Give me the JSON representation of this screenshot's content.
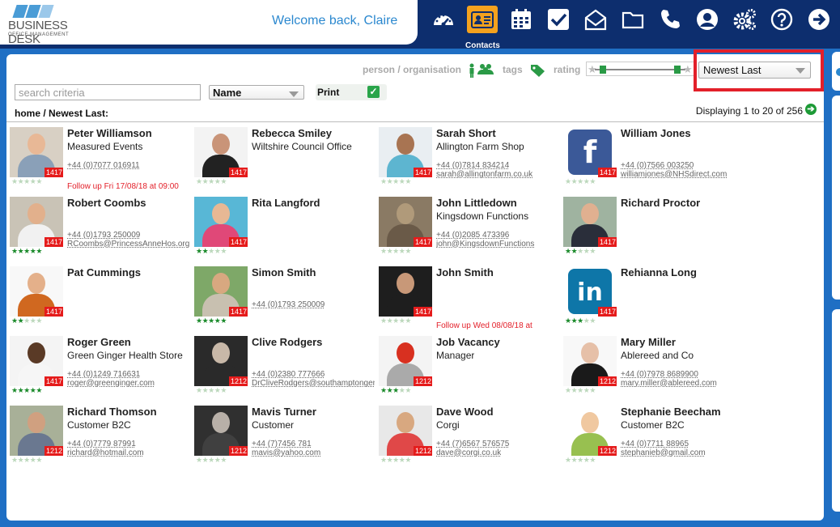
{
  "brand": {
    "name": "BUSINESS DESK",
    "tagline": "OFFICE MANAGEMENT"
  },
  "header": {
    "welcome": "Welcome back, Claire",
    "active_label": "Contacts"
  },
  "nav_icons": [
    "dashboard-icon",
    "contacts-icon",
    "calendar-icon",
    "tasks-icon",
    "mail-icon",
    "folder-icon",
    "phone-icon",
    "user-icon",
    "settings-icon",
    "help-icon",
    "logout-icon"
  ],
  "filters": {
    "person_org": "person / organisation",
    "tags": "tags",
    "rating": "rating"
  },
  "sort": {
    "selected": "Newest Last"
  },
  "search": {
    "placeholder": "search criteria",
    "field": "Name",
    "print": "Print"
  },
  "breadcrumb": "home / Newest Last:",
  "display": "Displaying 1 to 20 of 256",
  "colors": {
    "accent": "#f4a21e",
    "nav_bg": "#0d2e6e",
    "highlight": "#e3202a",
    "link": "#2b88cf"
  },
  "contacts": [
    {
      "name": "Peter Williamson",
      "org": "Measured Events",
      "phone": "+44 (0)7077 016911",
      "email": "",
      "badge": "1417",
      "rating": 0,
      "follow": "Follow up Fri 17/08/18 at 09:00",
      "photo": "#d8d0c4",
      "skin": "#e8b896",
      "shirt": "#8aa0b8"
    },
    {
      "name": "Rebecca Smiley",
      "org": "Wiltshire Council Office",
      "phone": "",
      "email": "",
      "badge": "1417",
      "rating": 0,
      "follow": "",
      "photo": "#f3f3f3",
      "skin": "#c99478",
      "shirt": "#222"
    },
    {
      "name": "Sarah Short",
      "org": "Allington Farm Shop",
      "phone": "+44 (0)7814 834214",
      "email": "sarah@allingtonfarm.co.uk",
      "badge": "1417",
      "rating": 0,
      "follow": "",
      "photo": "#e9eef2",
      "skin": "#a87452",
      "shirt": "#5db5d0"
    },
    {
      "name": "William Jones",
      "org": "",
      "phone": "+44 (0)7566 003250",
      "email": "williamjones@NHSdirect.com",
      "badge": "1417",
      "rating": 0,
      "follow": "",
      "photo": "fb",
      "skin": "",
      "shirt": ""
    },
    {
      "name": "Robert Coombs",
      "org": "",
      "phone": "+44 (0)1793 250009",
      "email": "RCoombs@PrincessAnneHos.org",
      "badge": "1417",
      "rating": 5,
      "follow": "",
      "photo": "#c9c3b6",
      "skin": "#e2b08c",
      "shirt": "#f1f1f1"
    },
    {
      "name": "Rita Langford",
      "org": "",
      "phone": "",
      "email": "",
      "badge": "1417",
      "rating": 2,
      "follow": "",
      "photo": "#58b7d6",
      "skin": "#e7b894",
      "shirt": "#e04878"
    },
    {
      "name": "John Littledown",
      "org": "Kingsdown Functions",
      "phone": "+44 (0)2085 473396",
      "email": "john@KingsdownFunctions",
      "badge": "1417",
      "rating": 0,
      "follow": "",
      "photo": "#8a7a64",
      "skin": "#b09a7a",
      "shirt": "#6a5a48"
    },
    {
      "name": "Richard Proctor",
      "org": "",
      "phone": "",
      "email": "",
      "badge": "1417",
      "rating": 2,
      "follow": "",
      "photo": "#9fb3a0",
      "skin": "#e0b090",
      "shirt": "#2a2e3a"
    },
    {
      "name": "Pat Cummings",
      "org": "",
      "phone": "",
      "email": "",
      "badge": "1417",
      "rating": 2,
      "follow": "",
      "photo": "#f8f8f8",
      "skin": "#e4b08a",
      "shirt": "#d06820"
    },
    {
      "name": "Simon Smith",
      "org": "",
      "phone": "+44 (0)1793 250009",
      "email": "",
      "badge": "1417",
      "rating": 5,
      "follow": "",
      "photo": "#7ea868",
      "skin": "#d8a880",
      "shirt": "#c8c0b0"
    },
    {
      "name": "John Smith",
      "org": "",
      "phone": "",
      "email": "",
      "badge": "1417",
      "rating": 0,
      "follow": "Follow up Wed 08/08/18 at",
      "photo": "#1e1e1e",
      "skin": "#c89878",
      "shirt": "#1e1e1e"
    },
    {
      "name": "Rehianna Long",
      "org": "",
      "phone": "",
      "email": "",
      "badge": "1417",
      "rating": 3,
      "follow": "",
      "photo": "li",
      "skin": "",
      "shirt": ""
    },
    {
      "name": "Roger Green",
      "org": "Green Ginger Health Store",
      "phone": "+44 (0)1249 716631",
      "email": "roger@greenginger.com",
      "badge": "1417",
      "rating": 5,
      "follow": "",
      "photo": "#f4f4f4",
      "skin": "#5a3a26",
      "shirt": "#f6f6f6"
    },
    {
      "name": "Clive Rodgers",
      "org": "",
      "phone": "+44 (0)2380 777666",
      "email": "DrCliveRodgers@southamptongen",
      "badge": "1212",
      "rating": 0,
      "follow": "",
      "photo": "#2a2a2a",
      "skin": "#c8b8a8",
      "shirt": "#2a2a2a"
    },
    {
      "name": "Job Vacancy",
      "org": "Manager",
      "phone": "",
      "email": "",
      "badge": "1212",
      "rating": 3,
      "follow": "",
      "photo": "#f4f4f4",
      "skin": "#d83020",
      "shirt": "#aaaaaa"
    },
    {
      "name": "Mary Miller",
      "org": "Ablereed and Co",
      "phone": "+44 (0)7978 8689900",
      "email": "mary.miller@ablereed.com",
      "badge": "1212",
      "rating": 0,
      "follow": "",
      "photo": "#f8f8f8",
      "skin": "#e6c0a8",
      "shirt": "#1a1a1a"
    },
    {
      "name": "Richard Thomson",
      "org": "Customer B2C",
      "phone": "+44 (0)7779 87991",
      "email": "richard@hotmail.com",
      "badge": "1212",
      "rating": 0,
      "follow": "",
      "photo": "#a8b098",
      "skin": "#d0a080",
      "shirt": "#6a7890"
    },
    {
      "name": "Mavis Turner",
      "org": "Customer",
      "phone": "+44 (7)7456 781",
      "email": "mavis@yahoo.com",
      "badge": "1212",
      "rating": 0,
      "follow": "",
      "photo": "#303030",
      "skin": "#b8b0a8",
      "shirt": "#404040"
    },
    {
      "name": "Dave Wood",
      "org": "Corgi",
      "phone": "+44 (7)6567 576575",
      "email": "dave@corgi.co.uk",
      "badge": "1212",
      "rating": 0,
      "follow": "",
      "photo": "#e8e8e8",
      "skin": "#d8a880",
      "shirt": "#e04848"
    },
    {
      "name": "Stephanie Beecham",
      "org": "Customer B2C",
      "phone": "+44 (0)7711 88965",
      "email": "stephanieb@gmail.com",
      "badge": "1212",
      "rating": 0,
      "follow": "",
      "photo": "#ffffff",
      "skin": "#f0c8a0",
      "shirt": "#98c050"
    }
  ]
}
